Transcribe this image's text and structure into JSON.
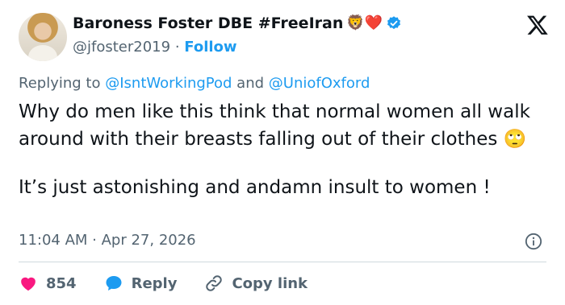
{
  "author": {
    "name": "Baroness Foster DBE #FreeIran",
    "name_emojis": "🦁❤️",
    "handle": "@jfoster2019",
    "separator": "·",
    "follow_label": "Follow"
  },
  "replying": {
    "prefix": "Replying to",
    "mention1": "@IsntWorkingPod",
    "conjunction": "and",
    "mention2": "@UniofOxford"
  },
  "tweet": {
    "paragraph1": "Why do men like this think that normal women all walk around with their breasts falling out of their clothes 🙄",
    "paragraph2": "It’s just astonishing and andamn insult to women !"
  },
  "meta": {
    "timestamp": "11:04 AM · Apr 27, 2026"
  },
  "actions": {
    "like_count": "854",
    "reply_label": "Reply",
    "copy_label": "Copy link"
  },
  "icons": {
    "like": "heart-icon",
    "reply": "speech-bubble-icon",
    "copy": "link-icon",
    "info": "info-icon",
    "verified": "verified-badge-icon",
    "brand": "x-logo-icon"
  },
  "colors": {
    "accent": "#1d9bf0",
    "like": "#f91880",
    "muted": "#536471",
    "text": "#0f1419"
  }
}
